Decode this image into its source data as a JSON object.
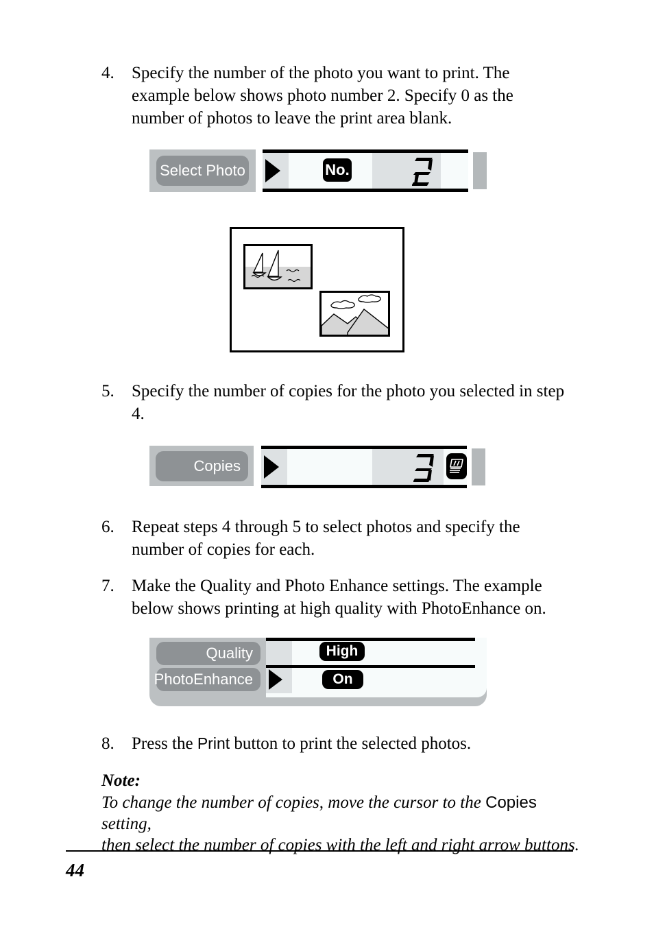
{
  "page": {
    "number": "44"
  },
  "steps": [
    {
      "num": "4.",
      "text": "Specify the number of the photo you want to print. The example below shows photo number 2. Specify 0 as the number of photos to leave the print area blank."
    },
    {
      "num": "5.",
      "text": "Specify the number of copies for the photo you selected in step 4."
    },
    {
      "num": "6.",
      "text": "Repeat steps 4 through 5 to select photos and specify the number of copies for each."
    },
    {
      "num": "7.",
      "text": "Make the Quality and Photo Enhance settings. The example below shows printing at high quality with PhotoEnhance on."
    }
  ],
  "step8": {
    "num": "8.",
    "before": "Press the ",
    "button_name": "Print",
    "after": " button to print the selected photos."
  },
  "panels": {
    "select_photo": {
      "label": "Select Photo",
      "cursor": "cursor-arrow-icon",
      "field_tag": "No.",
      "value": "2"
    },
    "copies": {
      "label": "Copies",
      "cursor": "cursor-arrow-icon",
      "value": "3",
      "icon": "stacked-sheets-icon"
    },
    "quality": {
      "rows": [
        {
          "label": "Quality",
          "value": "High",
          "cursor": false
        },
        {
          "label": "PhotoEnhance",
          "value": "On",
          "cursor": true
        }
      ]
    }
  },
  "illustration": {
    "name": "print-layout-example",
    "photos": [
      {
        "name": "sailboats-photo"
      },
      {
        "name": "mountains-photo"
      }
    ]
  },
  "note": {
    "heading": "Note:",
    "line1_before": "To change the number of copies, move the cursor to the ",
    "line1_button": "Copies",
    "line1_after": " setting,",
    "line2": "then select the number of copies with the left and right arrow buttons."
  },
  "colors": {
    "tray_gray": "#bcc0c2",
    "label_gray": "#8e9295",
    "lcd_bg": "#f7fbfb",
    "cell_gray": "#dde1e3",
    "ink_black": "#000000"
  }
}
